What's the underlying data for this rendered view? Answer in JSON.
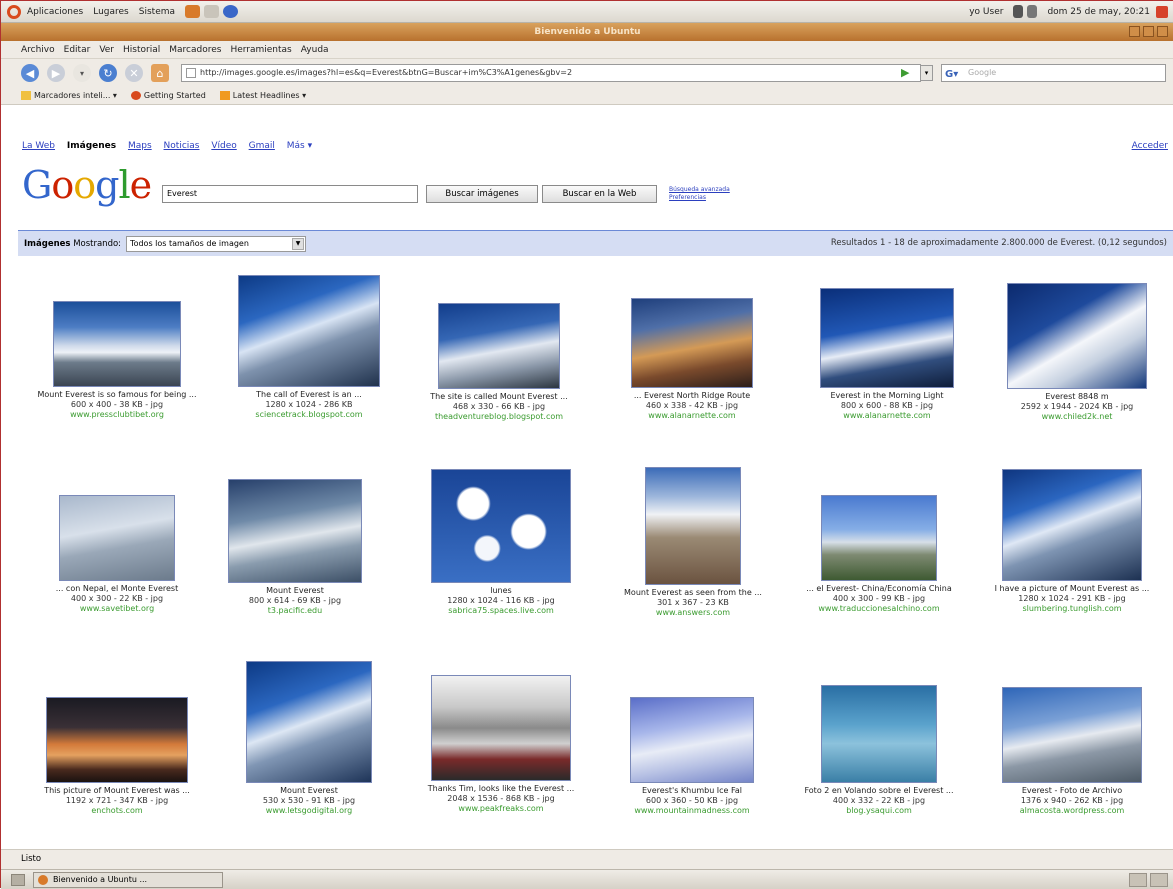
{
  "panel": {
    "menus": [
      "Aplicaciones",
      "Lugares",
      "Sistema"
    ],
    "user": "yo User",
    "clock": "dom 25 de may, 20:21"
  },
  "window": {
    "title": "Bienvenido a Ubuntu"
  },
  "menubar": [
    "Archivo",
    "Editar",
    "Ver",
    "Historial",
    "Marcadores",
    "Herramientas",
    "Ayuda"
  ],
  "url": "http://images.google.es/images?hl=es&q=Everest&btnG=Buscar+im%C3%A1genes&gbv=2",
  "search_placeholder": "Google",
  "bookmarks": [
    "Marcadores inteli... ▾",
    "Getting Started",
    "Latest Headlines ▾"
  ],
  "google": {
    "nav": [
      "La Web",
      "Imágenes",
      "Maps",
      "Noticias",
      "Vídeo",
      "Gmail",
      "Más ▾"
    ],
    "signin": "Acceder",
    "logo": [
      "G",
      "o",
      "o",
      "g",
      "l",
      "e"
    ],
    "query": "Everest",
    "btn_images": "Buscar imágenes",
    "btn_web": "Buscar en la Web",
    "adv_search": "Búsqueda avanzada",
    "prefs": "Preferencias",
    "label_images": "Imágenes",
    "label_showing": "Mostrando:",
    "size_filter": "Todos los tamaños de imagen",
    "results_text": "Resultados 1 - 18 de aproximadamente 2.800.000 de Everest. (0,12 segundos)"
  },
  "results": [
    {
      "caption": "Mount Everest is so famous for being ...",
      "dims": "600 x 400 - 38 KB - jpg",
      "url": "www.pressclubtibet.org"
    },
    {
      "caption": "The call of Everest is an ...",
      "dims": "1280 x 1024 - 286 KB",
      "url": "sciencetrack.blogspot.com"
    },
    {
      "caption": "The site is called Mount Everest ...",
      "dims": "468 x 330 - 66 KB - jpg",
      "url": "theadventureblog.blogspot.com"
    },
    {
      "caption": "... Everest North Ridge Route",
      "dims": "460 x 338 - 42 KB - jpg",
      "url": "www.alanarnette.com"
    },
    {
      "caption": "Everest in the Morning Light",
      "dims": "800 x 600 - 88 KB - jpg",
      "url": "www.alanarnette.com"
    },
    {
      "caption": "Everest 8848 m",
      "dims": "2592 x 1944 - 2024 KB - jpg",
      "url": "www.chiled2k.net"
    },
    {
      "caption": "... con Nepal, el Monte Everest",
      "dims": "400 x 300 - 22 KB - jpg",
      "url": "www.savetibet.org"
    },
    {
      "caption": "Mount Everest",
      "dims": "800 x 614 - 69 KB - jpg",
      "url": "t3.pacific.edu"
    },
    {
      "caption": "lunes",
      "dims": "1280 x 1024 - 116 KB - jpg",
      "url": "sabrica75.spaces.live.com"
    },
    {
      "caption": "Mount Everest as seen from the ...",
      "dims": "301 x 367 - 23 KB",
      "url": "www.answers.com"
    },
    {
      "caption": "... el Everest- China/Economía China",
      "dims": "400 x 300 - 99 KB - jpg",
      "url": "www.traduccionesalchino.com"
    },
    {
      "caption": "I have a picture of Mount Everest as ...",
      "dims": "1280 x 1024 - 291 KB - jpg",
      "url": "slumbering.tunglish.com"
    },
    {
      "caption": "This picture of Mount Everest was ...",
      "dims": "1192 x 721 - 347 KB - jpg",
      "url": "enchots.com"
    },
    {
      "caption": "Mount Everest",
      "dims": "530 x 530 - 91 KB - jpg",
      "url": "www.letsgodigital.org"
    },
    {
      "caption": "Thanks Tim, looks like the Everest ...",
      "dims": "2048 x 1536 - 868 KB - jpg",
      "url": "www.peakfreaks.com"
    },
    {
      "caption": "Everest's Khumbu Ice Fal",
      "dims": "600 x 360 - 50 KB - jpg",
      "url": "www.mountainmadness.com"
    },
    {
      "caption": "Foto 2 en Volando sobre el Everest ...",
      "dims": "400 x 332 - 22 KB - jpg",
      "url": "blog.ysaqui.com"
    },
    {
      "caption": "Everest - Foto de Archivo",
      "dims": "1376 x 940 - 262 KB - jpg",
      "url": "almacosta.wordpress.com"
    }
  ],
  "status": "Listo",
  "task": "Bienvenido a Ubuntu ..."
}
